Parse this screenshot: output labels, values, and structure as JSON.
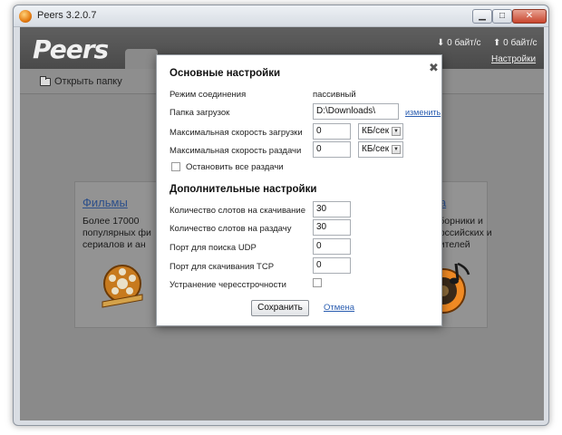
{
  "window": {
    "title": "Peers 3.2.0.7",
    "minimize_glyph": "▁",
    "maximize_glyph": "□",
    "close_glyph": "✕"
  },
  "header": {
    "logo": "Peers",
    "download_speed": "0 байт/с",
    "upload_speed": "0 байт/с",
    "settings_link": "Настройки"
  },
  "toolbar": {
    "open_folder": "Открыть папку"
  },
  "cards": {
    "left": {
      "title": "Фильмы",
      "text": "Более 17000 популярных фи сериалов и ан"
    },
    "right": {
      "title": "ка",
      "text": "сборники и российских и нителей"
    }
  },
  "dialog": {
    "close_glyph": "✖",
    "main_section": "Основные настройки",
    "connection_mode_label": "Режим соединения",
    "connection_mode_value": "пассивный",
    "download_folder_label": "Папка загрузок",
    "download_folder_value": "D:\\Downloads\\",
    "change_link": "изменить",
    "max_download_label": "Максимальная скорость загрузки",
    "max_download_value": "0",
    "max_download_unit": "КБ/сек",
    "max_upload_label": "Максимальная скорость раздачи",
    "max_upload_value": "0",
    "max_upload_unit": "КБ/сек",
    "stop_all_label": "Остановить все раздачи",
    "extra_section": "Дополнительные настройки",
    "download_slots_label": "Количество слотов на скачивание",
    "download_slots_value": "30",
    "upload_slots_label": "Количество слотов на раздачу",
    "upload_slots_value": "30",
    "udp_port_label": "Порт для поиска UDP",
    "udp_port_value": "0",
    "tcp_port_label": "Порт для скачивания TCP",
    "tcp_port_value": "0",
    "interlace_label": "Устранение чересстрочности",
    "save_button": "Сохранить",
    "cancel_link": "Отмена"
  }
}
